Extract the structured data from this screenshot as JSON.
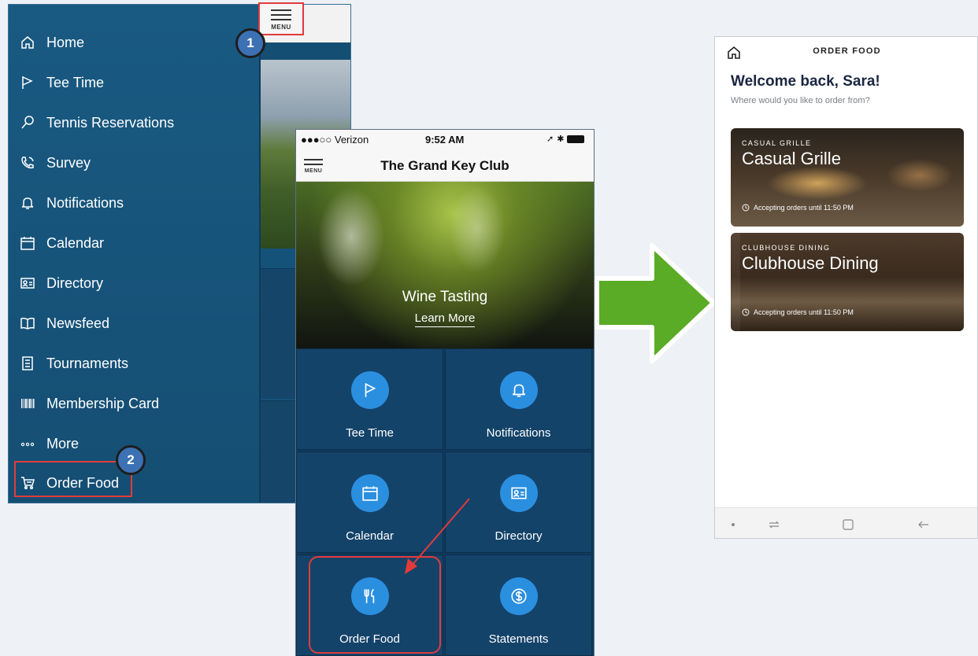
{
  "drawer": {
    "items": [
      {
        "label": "Home",
        "icon": "home-icon"
      },
      {
        "label": "Tee Time",
        "icon": "flag-icon"
      },
      {
        "label": "Tennis Reservations",
        "icon": "tennis-racket-icon"
      },
      {
        "label": "Survey",
        "icon": "phone-icon"
      },
      {
        "label": "Notifications",
        "icon": "bell-icon"
      },
      {
        "label": "Calendar",
        "icon": "calendar-icon"
      },
      {
        "label": "Directory",
        "icon": "id-card-icon"
      },
      {
        "label": "Newsfeed",
        "icon": "book-icon"
      },
      {
        "label": "Tournaments",
        "icon": "list-icon"
      },
      {
        "label": "Membership Card",
        "icon": "barcode-icon"
      },
      {
        "label": "More",
        "icon": "more-dots-icon"
      },
      {
        "label": "Order Food",
        "icon": "cart-icon"
      }
    ],
    "menu_label": "MENU"
  },
  "badges": {
    "one": "1",
    "two": "2"
  },
  "phone": {
    "carrier": "●●●○○ Verizon",
    "time": "9:52 AM",
    "menu_label": "MENU",
    "title": "The Grand Key Club",
    "hero_title": "Wine Tasting",
    "hero_link": "Learn More",
    "tiles": [
      {
        "label": "Tee Time",
        "icon": "flag-icon"
      },
      {
        "label": "Notifications",
        "icon": "bell-icon"
      },
      {
        "label": "Calendar",
        "icon": "calendar-icon"
      },
      {
        "label": "Directory",
        "icon": "id-card-icon"
      },
      {
        "label": "Order Food",
        "icon": "fork-knife-icon"
      },
      {
        "label": "Statements",
        "icon": "dollar-icon"
      }
    ]
  },
  "order_food": {
    "title": "ORDER FOOD",
    "welcome": "Welcome back, Sara!",
    "subtitle": "Where would you like to order from?",
    "venues": [
      {
        "kicker": "CASUAL GRILLE",
        "name": "Casual Grille",
        "status": "Accepting orders until 11:50 PM"
      },
      {
        "kicker": "CLUBHOUSE DINING",
        "name": "Clubhouse Dining",
        "status": "Accepting orders until 11:50 PM"
      }
    ]
  },
  "colors": {
    "drawer_blue": "#195a82",
    "tile_blue": "#14436a",
    "icon_circle": "#2b8fe0",
    "highlight_red": "#e23b3b",
    "arrow_green": "#5aab25",
    "welcome_navy": "#1a2540"
  }
}
